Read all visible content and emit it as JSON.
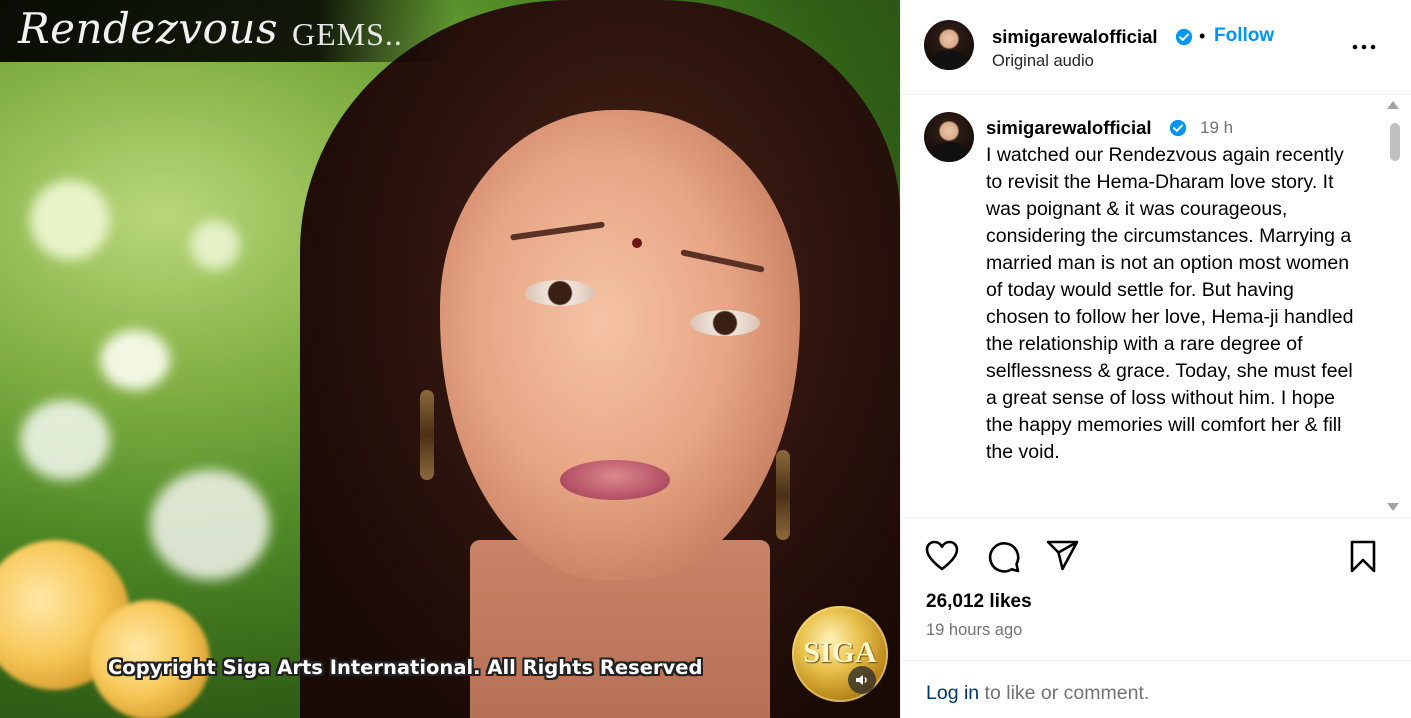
{
  "media": {
    "banner_script": "Rendezvous",
    "banner_caps": "GEMS..",
    "watermark": "Copyright Siga Arts International. All Rights Reserved",
    "logo_text": "SIGA",
    "audio_icon": "speaker-icon"
  },
  "header": {
    "username": "simigarewalofficial",
    "follow_separator": "•",
    "follow_label": "Follow",
    "subtitle": "Original audio",
    "more_icon": "more-options-icon"
  },
  "caption": {
    "username": "simigarewalofficial",
    "time": "19 h",
    "text": "I watched our Rendezvous again recently to revisit the Hema-Dharam love story. It was poignant & it was courageous, considering the circumstances. Marrying a married man is not an option most women of today would settle for. But having chosen to follow her love, Hema-ji handled the relationship with a rare degree of selflessness & grace. Today, she must feel a great sense of loss without him.  I hope the happy memories will comfort her & fill the void."
  },
  "actions": {
    "icons": [
      "heart-icon",
      "comment-icon",
      "share-icon",
      "bookmark-icon"
    ]
  },
  "stats": {
    "likes": "26,012 likes",
    "time_ago": "19 hours ago"
  },
  "footer": {
    "login_link": "Log in",
    "login_rest": " to like or comment."
  },
  "colors": {
    "accent": "#0095f6",
    "verified": "#0095f6",
    "muted": "#737373",
    "link": "#00376b"
  }
}
